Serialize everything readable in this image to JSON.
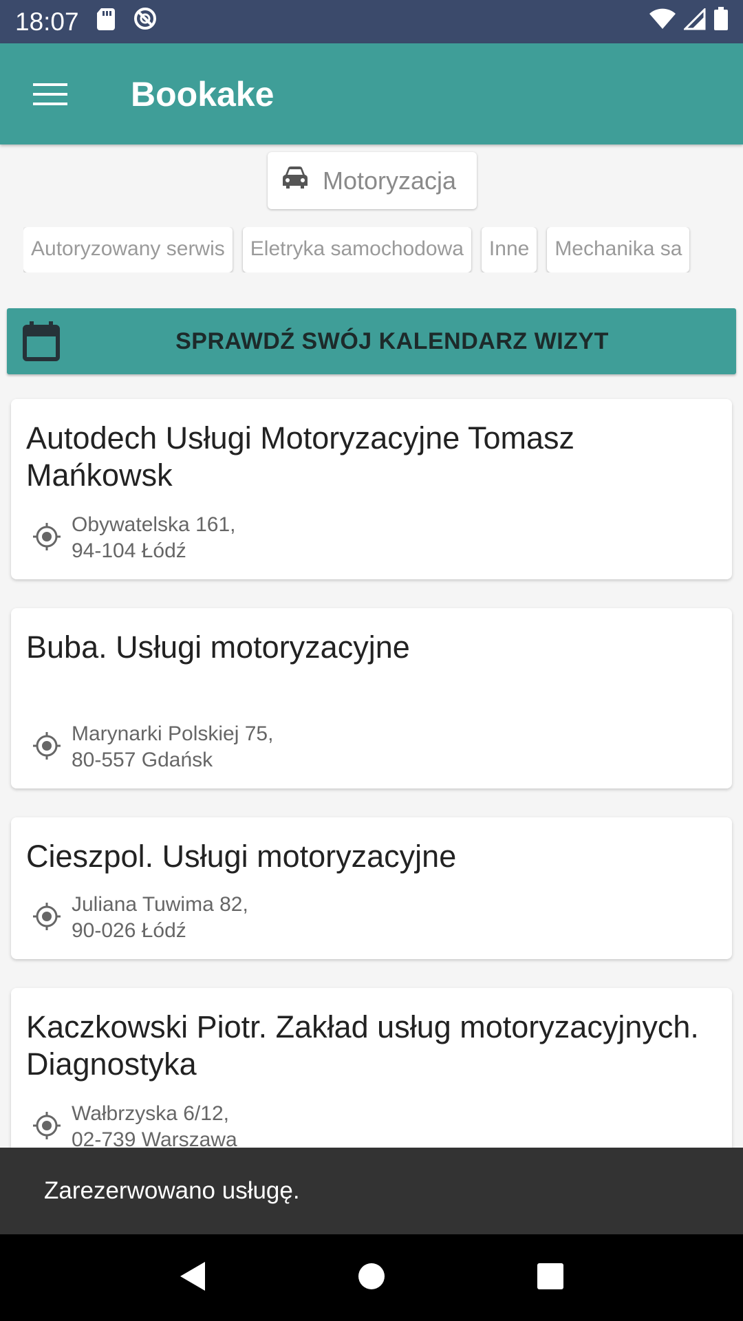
{
  "status_bar": {
    "time": "18:07",
    "icons_left": [
      "sd-card-icon",
      "sync-icon"
    ],
    "icons_right": [
      "wifi-icon",
      "signal-icon",
      "battery-icon"
    ]
  },
  "app_bar": {
    "title": "Bookake",
    "menu_icon": "menu-icon"
  },
  "category": {
    "label": "Motoryzacja",
    "icon": "car-icon"
  },
  "subcategories": [
    "Autoryzowany serwis",
    "Eletryka samochodowa",
    "Inne",
    "Mechanika sa"
  ],
  "calendar_button": {
    "label": "SPRAWDŹ SWÓJ KALENDARZ WIZYT",
    "icon": "calendar-icon"
  },
  "businesses": [
    {
      "name": "Autodech Usługi Motoryzacyjne Tomasz Mańkowsk",
      "address_line1": "Obywatelska 161,",
      "address_line2": "94-104 Łódź"
    },
    {
      "name": "Buba. Usługi motoryzacyjne",
      "address_line1": "Marynarki Polskiej 75,",
      "address_line2": "80-557 Gdańsk"
    },
    {
      "name": "Cieszpol. Usługi motoryzacyjne",
      "address_line1": "Juliana Tuwima 82,",
      "address_line2": "90-026 Łódź"
    },
    {
      "name": "Kaczkowski Piotr. Zakład usług motoryzacyjnych. Diagnostyka",
      "address_line1": "Wałbrzyska 6/12,",
      "address_line2": "02-739 Warszawa"
    }
  ],
  "snackbar": {
    "message": "Zarezerwowano usługę."
  },
  "colors": {
    "primary": "#3f9e98",
    "status_bar": "#3b4a6b",
    "snackbar": "#333333"
  }
}
